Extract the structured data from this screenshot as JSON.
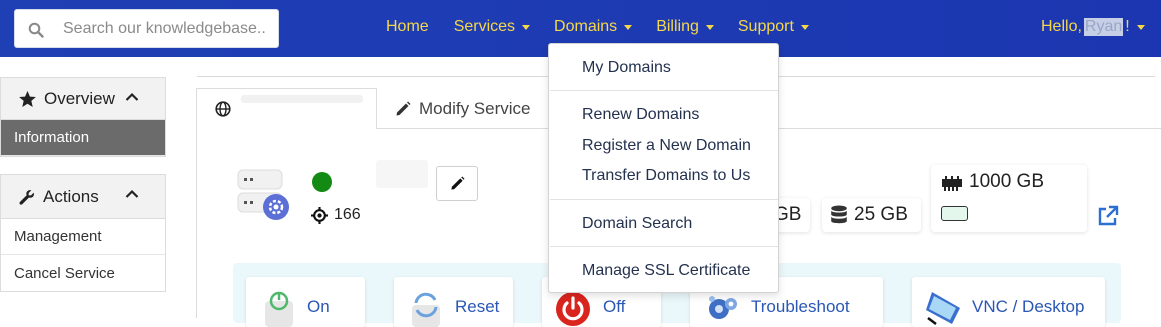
{
  "search": {
    "placeholder": "Search our knowledgebase.."
  },
  "nav": {
    "items": [
      {
        "label": "Home",
        "caret": false
      },
      {
        "label": "Services",
        "caret": true
      },
      {
        "label": "Domains",
        "caret": true
      },
      {
        "label": "Billing",
        "caret": true
      },
      {
        "label": "Support",
        "caret": true
      }
    ],
    "hello_prefix": "Hello, ",
    "user_name": "Ryan",
    "hello_suffix": "!"
  },
  "sidebar": {
    "overview_title": "Overview",
    "information": "Information",
    "actions_title": "Actions",
    "management": "Management",
    "cancel_service": "Cancel Service"
  },
  "tabs": {
    "modify_service": "Modify Service"
  },
  "server": {
    "ip_count": "166",
    "disk_partial": "GB",
    "storage": "25 GB",
    "bandwidth": "1000 GB",
    "bandwidth_used_fraction": 0.01
  },
  "actions": {
    "on": "On",
    "reset": "Reset",
    "off": "Off",
    "troubleshoot": "Troubleshoot",
    "vnc": "VNC / Desktop"
  },
  "domains_menu": {
    "my_domains": "My Domains",
    "renew": "Renew Domains",
    "register": "Register a New Domain",
    "transfer": "Transfer Domains to Us",
    "search": "Domain Search",
    "ssl": "Manage SSL Certificate"
  },
  "colors": {
    "nav_bg": "#1f3fb4",
    "nav_text": "#f5d84a",
    "status_online": "#138a13",
    "action_text": "#2a57b5",
    "power_off": "#d9251d"
  }
}
